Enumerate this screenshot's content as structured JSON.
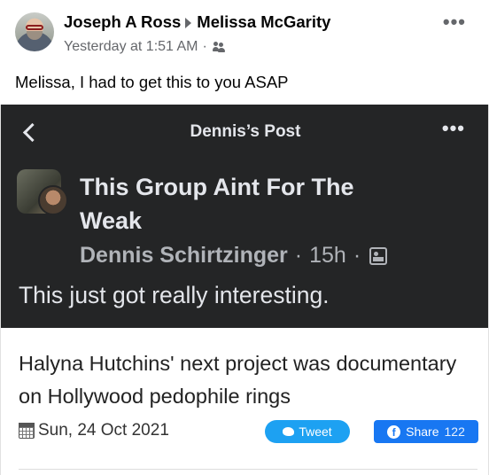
{
  "post": {
    "author": "Joseph A Ross",
    "recipient": "Melissa McGarity",
    "timestamp": "Yesterday at 1:51 AM",
    "separator": "·",
    "audience_icon": "friends-icon",
    "more_icon": "more-options-icon",
    "text": "Melissa, I had to get this to you ASAP"
  },
  "screenshot": {
    "header_title": "Dennis’s Post",
    "back_icon": "chevron-left-icon",
    "more_icon": "more-options-icon",
    "group_name": "This Group Aint For The Weak",
    "author": "Dennis Schirtzinger",
    "separator": "·",
    "time": "15h",
    "separator2": "·",
    "privacy_icon": "photo-icon",
    "body": "This just got really interesting."
  },
  "article": {
    "headline": "Halyna Hutchins' next project was documentary on Hollywood pedophile rings",
    "date": "Sun, 24 Oct 2021",
    "calendar_icon": "calendar-icon",
    "tweet_label": "Tweet",
    "share_label": "Share",
    "share_count": "122"
  },
  "colors": {
    "dark_bg": "#242526",
    "twitter_blue": "#1da1f2",
    "facebook_blue": "#1877f2",
    "secondary_text": "#65676b"
  }
}
